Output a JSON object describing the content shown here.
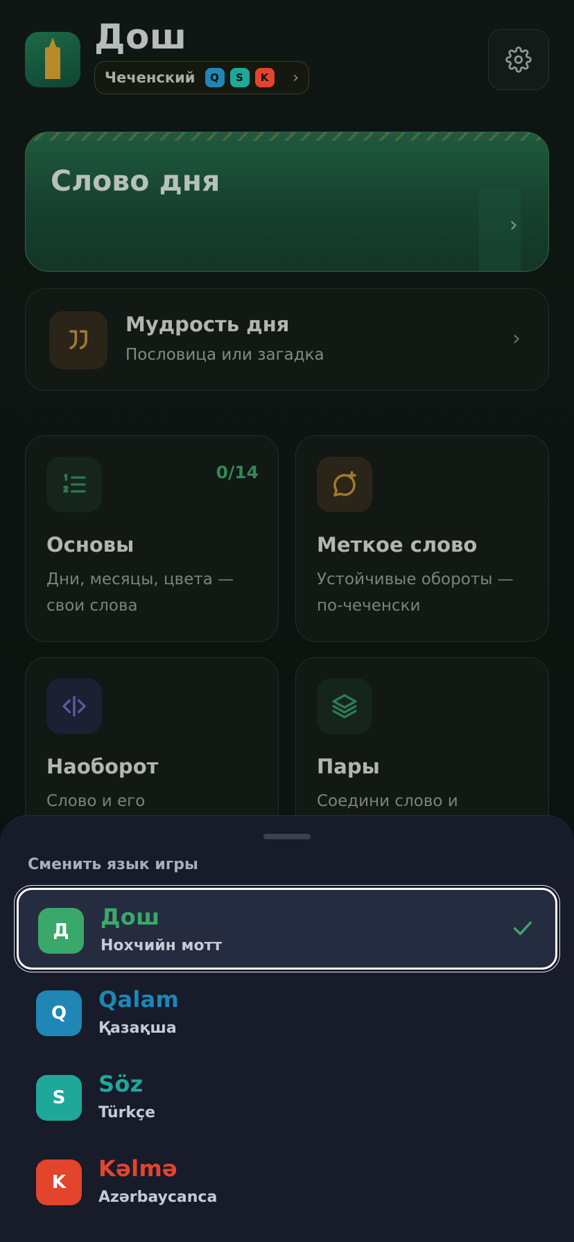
{
  "header": {
    "title": "Дош",
    "language_label": "Чеченский",
    "mini_badges": [
      {
        "letter": "Q",
        "color": "#1f86b6"
      },
      {
        "letter": "S",
        "color": "#1fa89a"
      },
      {
        "letter": "K",
        "color": "#e2452c"
      }
    ],
    "icons": {
      "app": "tower-icon",
      "settings": "gear-icon"
    }
  },
  "word_of_day": {
    "title": "Слово дня"
  },
  "wisdom": {
    "title": "Мудрость дня",
    "subtitle": "Пословица или загадка",
    "icon": "quote-icon"
  },
  "cards": [
    {
      "title": "Основы",
      "desc": "Дни, месяцы, цвета — свои слова",
      "count": "0/14",
      "icon": "numbered-list-icon"
    },
    {
      "title": "Меткое слово",
      "desc": "Устойчивые обороты — по-чеченски",
      "icon": "chat-plus-icon"
    },
    {
      "title": "Наоборот",
      "desc": "Слово и его",
      "icon": "code-arrows-icon"
    },
    {
      "title": "Пары",
      "desc": "Соедини слово и",
      "icon": "layers-icon"
    }
  ],
  "sheet": {
    "heading": "Сменить язык игры",
    "languages": [
      {
        "letter": "Д",
        "name": "Дош",
        "native": "Нохчийн мотт",
        "color": "#3aa86a",
        "selected": true
      },
      {
        "letter": "Q",
        "name": "Qalam",
        "native": "Қазақша",
        "color": "#1f86b6",
        "selected": false
      },
      {
        "letter": "S",
        "name": "Söz",
        "native": "Türkçe",
        "color": "#1fa89a",
        "selected": false
      },
      {
        "letter": "K",
        "name": "Kəlmə",
        "native": "Azərbaycanca",
        "color": "#e2452c",
        "selected": false
      }
    ]
  },
  "colors": {
    "accent_green": "#3aa86a",
    "check_green": "#3aa86a"
  }
}
